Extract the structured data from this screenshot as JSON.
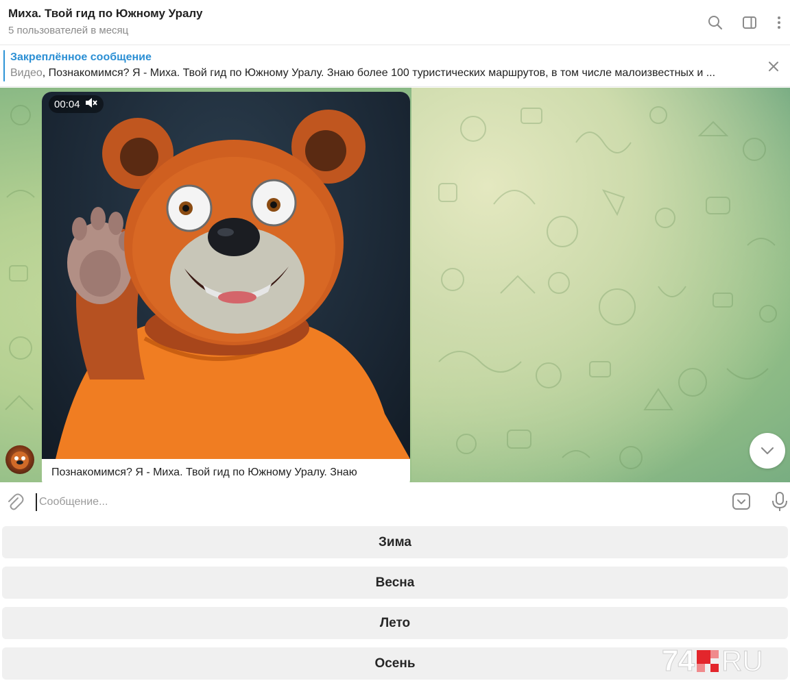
{
  "header": {
    "title": "Миха. Твой гид по Южному Уралу",
    "subtitle": "5 пользователей в месяц",
    "icons": [
      "search-icon",
      "sidebar-toggle-icon",
      "more-vert-icon"
    ]
  },
  "pinned": {
    "title": "Закреплённое сообщение",
    "kind": "Видео",
    "text": ", Познакомимся? Я - Миха. Твой гид по Южному Уралу. Знаю более 100 туристических маршрутов, в том числе малоизвестных и ..."
  },
  "message": {
    "video_time": "00:04",
    "muted_icon": "speaker-muted-icon",
    "caption": "Познакомимся? Я - Миха. Твой гид по Южному Уралу. Знаю"
  },
  "composer": {
    "placeholder": "Сообщение..."
  },
  "keyboard": {
    "buttons": [
      "Зима",
      "Весна",
      "Лето",
      "Осень"
    ]
  },
  "watermark": {
    "number": "74",
    "suffix": "RU"
  },
  "colors": {
    "accent": "#2b8fd4",
    "watermark_red": "#e3262c"
  }
}
